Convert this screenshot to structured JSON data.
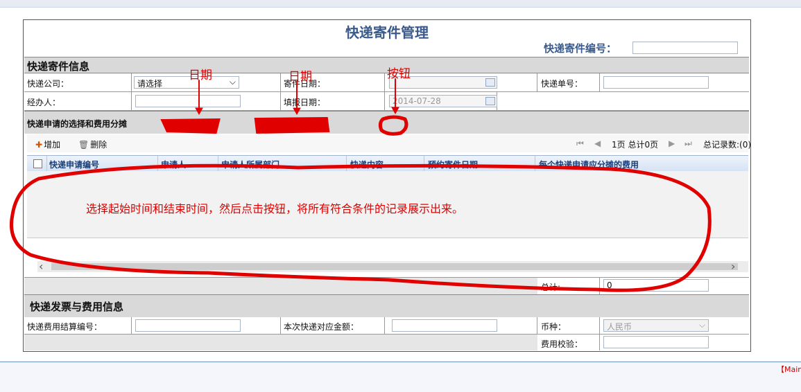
{
  "header": {
    "title": "快递寄件管理",
    "number_label": "快递寄件编号："
  },
  "section_info": {
    "title": "快递寄件信息"
  },
  "fields": {
    "company_label": "快递公司：",
    "company_value": "请选择",
    "send_date_label": "寄件日期：",
    "tracking_label": "快递单号：",
    "handler_label": "经办人：",
    "report_date_label": "填报日期：",
    "report_date_value": "2014-07-28"
  },
  "section_select": {
    "title": "快递申请的选择和费用分摊"
  },
  "toolbar": {
    "add_label": "增加",
    "delete_label": "删除",
    "page_info": "1页 总计0页",
    "total_records": "总记录数:(0)"
  },
  "grid": {
    "columns": [
      "快递申请编号",
      "申请人",
      "申请人所属部门",
      "快递内容",
      "预约寄件日期",
      "每个快递申请应分摊的费用"
    ]
  },
  "total": {
    "label": "总计:",
    "value": "0"
  },
  "section_invoice": {
    "title": "快递发票与费用信息"
  },
  "invoice": {
    "settle_label": "快递费用结算编号：",
    "amount_label": "本次快递对应金额：",
    "currency_label": "币种：",
    "currency_value": "人民币",
    "verify_label": "费用校验："
  },
  "annotations": {
    "date1": "日期",
    "date2": "日期",
    "button": "按钮",
    "description": "选择起始时间和结束时间，然后点击按钮，将所有符合条件的记录展示出来。"
  },
  "footer": {
    "main_link": "【Main"
  },
  "colors": {
    "title": "#3a5a8c",
    "annotation": "#e00000",
    "grid_header_text": "#1a3f7a"
  }
}
